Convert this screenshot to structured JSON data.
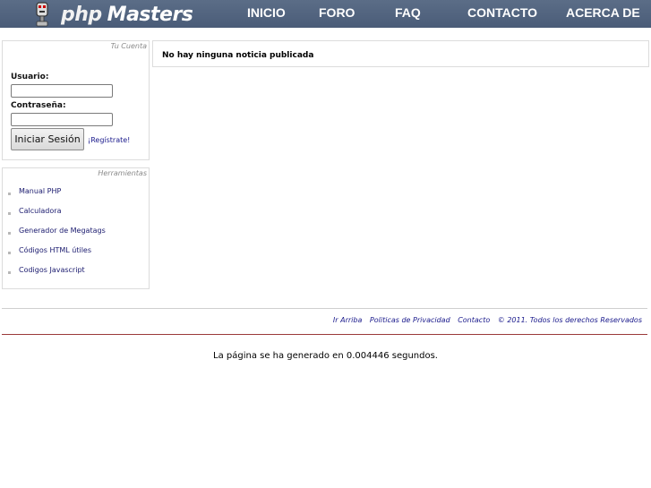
{
  "header": {
    "logo_php": "php",
    "logo_masters": "Masters",
    "nav": [
      "INICIO",
      "FORO",
      "FAQ",
      "CONTACTO",
      "ACERCA DE"
    ]
  },
  "login": {
    "title": "Tu Cuenta",
    "user_label": "Usuario:",
    "user_value": "",
    "pass_label": "Contraseña:",
    "pass_value": "",
    "submit": "Iniciar Sesión",
    "register": "¡Regístrate!"
  },
  "tools": {
    "title": "Herramientas",
    "items": [
      "Manual PHP",
      "Calculadora",
      "Generador de Megatags",
      "Códigos HTML útiles",
      "Codigos Javascript"
    ]
  },
  "news": {
    "empty_message": "No hay ninguna noticia publicada"
  },
  "footer": {
    "links": [
      "Ir Arriba",
      "Politicas de Privacidad",
      "Contacto"
    ],
    "copyright": "© 2011. Todos los derechos Reservados",
    "generated": "La página se ha generado en 0.004446 segundos."
  },
  "colors": {
    "header": "#4f617c",
    "link": "#1a1a8c",
    "rule": "#9b3b3b"
  },
  "icons": {
    "logo": "microphone-robot-icon"
  }
}
